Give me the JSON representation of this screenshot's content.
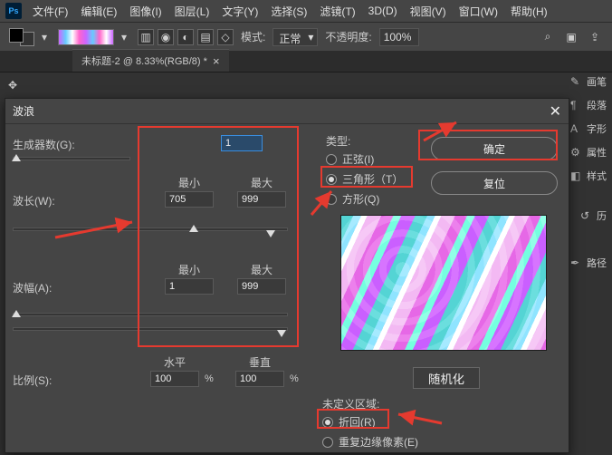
{
  "menubar": {
    "items": [
      "文件(F)",
      "编辑(E)",
      "图像(I)",
      "图层(L)",
      "文字(Y)",
      "选择(S)",
      "滤镜(T)",
      "3D(D)",
      "视图(V)",
      "窗口(W)",
      "帮助(H)"
    ]
  },
  "optionsbar": {
    "mode_label": "模式:",
    "mode_value": "正常",
    "opacity_label": "不透明度:",
    "opacity_value": "100%"
  },
  "doc_tab": {
    "label": "未标题-2 @ 8.33%(RGB/8) *"
  },
  "right_panel": {
    "items": [
      "画笔",
      "段落",
      "字形",
      "属性",
      "样式",
      "历",
      "路径"
    ]
  },
  "dialog": {
    "title": "波浪",
    "generators_label": "生成器数(G):",
    "generators_value": "1",
    "wavelength_label": "波长(W):",
    "amplitude_label": "波幅(A):",
    "scale_label": "比例(S):",
    "min_header": "最小",
    "max_header": "最大",
    "wavelength_min": "705",
    "wavelength_max": "999",
    "amplitude_min": "1",
    "amplitude_max": "999",
    "horiz_label": "水平",
    "vert_label": "垂直",
    "scale_h": "100",
    "scale_v": "100",
    "pct": "%",
    "type_group": "类型:",
    "type_options": {
      "sine": "正弦(I)",
      "triangle": "三角形（T）",
      "square": "方形(Q)"
    },
    "ok_label": "确定",
    "reset_label": "复位",
    "randomize_label": "随机化",
    "undefined_group": "未定义区域:",
    "undefined_options": {
      "wrap": "折回(R)",
      "repeat": "重复边缘像素(E)"
    }
  }
}
